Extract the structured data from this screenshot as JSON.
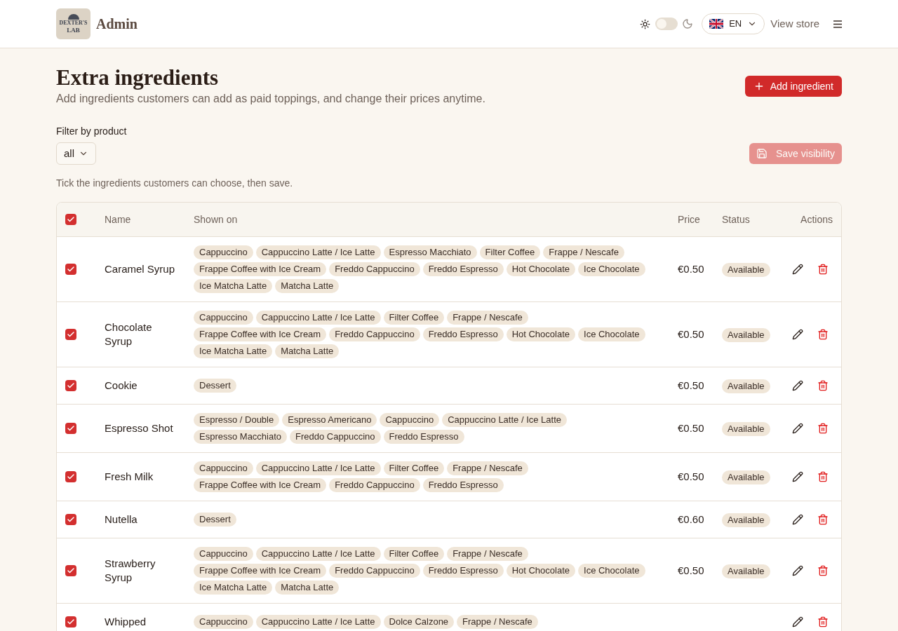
{
  "header": {
    "logo": {
      "lines": [
        "DEXTER'S",
        "LAB"
      ]
    },
    "title": "Admin",
    "theme_toggle": {
      "on": false
    },
    "language": {
      "code": "EN"
    },
    "view_store": "View store"
  },
  "page": {
    "title": "Extra ingredients",
    "subtitle": "Add ingredients customers can add as paid toppings, and change their prices anytime.",
    "add_button": "Add ingredient",
    "filter": {
      "label": "Filter by product",
      "value": "all"
    },
    "save_button": {
      "label": "Save visibility",
      "disabled": true
    },
    "hint": "Tick the ingredients customers can choose, then save."
  },
  "table": {
    "select_all": {
      "checked": true
    },
    "columns": [
      "Name",
      "Shown on",
      "Price",
      "Status",
      "Actions"
    ],
    "rows": [
      {
        "checked": true,
        "name": "Caramel Syrup",
        "shown_on": [
          "Cappuccino",
          "Cappuccino Latte / Ice Latte",
          "Espresso Macchiato",
          "Filter Coffee",
          "Frappe / Nescafe",
          "Frappe Coffee with Ice Cream",
          "Freddo Cappuccino",
          "Freddo Espresso",
          "Hot Chocolate",
          "Ice Chocolate",
          "Ice Matcha Latte",
          "Matcha Latte"
        ],
        "price": "€0.50",
        "status": "Available"
      },
      {
        "checked": true,
        "name": "Chocolate Syrup",
        "shown_on": [
          "Cappuccino",
          "Cappuccino Latte / Ice Latte",
          "Filter Coffee",
          "Frappe / Nescafe",
          "Frappe Coffee with Ice Cream",
          "Freddo Cappuccino",
          "Freddo Espresso",
          "Hot Chocolate",
          "Ice Chocolate",
          "Ice Matcha Latte",
          "Matcha Latte"
        ],
        "price": "€0.50",
        "status": "Available"
      },
      {
        "checked": true,
        "name": "Cookie",
        "shown_on": [
          "Dessert"
        ],
        "price": "€0.50",
        "status": "Available"
      },
      {
        "checked": true,
        "name": "Espresso Shot",
        "shown_on": [
          "Espresso / Double",
          "Espresso Americano",
          "Cappuccino",
          "Cappuccino Latte / Ice Latte",
          "Espresso Macchiato",
          "Freddo Cappuccino",
          "Freddo Espresso"
        ],
        "price": "€0.50",
        "status": "Available"
      },
      {
        "checked": true,
        "name": "Fresh Milk",
        "shown_on": [
          "Cappuccino",
          "Cappuccino Latte / Ice Latte",
          "Filter Coffee",
          "Frappe / Nescafe",
          "Frappe Coffee with Ice Cream",
          "Freddo Cappuccino",
          "Freddo Espresso"
        ],
        "price": "€0.50",
        "status": "Available"
      },
      {
        "checked": true,
        "name": "Nutella",
        "shown_on": [
          "Dessert"
        ],
        "price": "€0.60",
        "status": "Available"
      },
      {
        "checked": true,
        "name": "Strawberry Syrup",
        "shown_on": [
          "Cappuccino",
          "Cappuccino Latte / Ice Latte",
          "Filter Coffee",
          "Frappe / Nescafe",
          "Frappe Coffee with Ice Cream",
          "Freddo Cappuccino",
          "Freddo Espresso",
          "Hot Chocolate",
          "Ice Chocolate",
          "Ice Matcha Latte",
          "Matcha Latte"
        ],
        "price": "€0.50",
        "status": "Available"
      },
      {
        "checked": true,
        "name": "Whipped",
        "shown_on": [
          "Cappuccino",
          "Cappuccino Latte / Ice Latte",
          "Dolce Calzone",
          "Frappe / Nescafe"
        ]
      }
    ]
  }
}
